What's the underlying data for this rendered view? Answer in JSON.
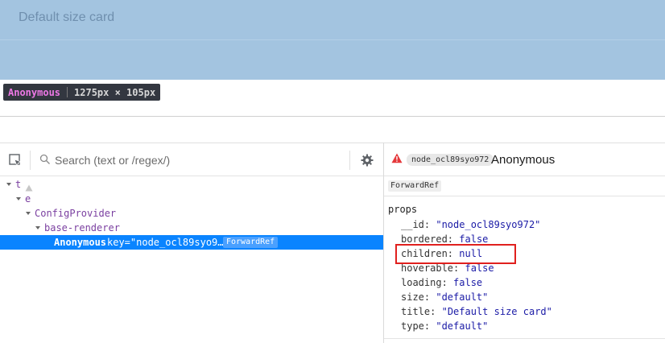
{
  "card": {
    "title": "Default size card"
  },
  "tooltip": {
    "name": "Anonymous",
    "size": "1275px × 105px"
  },
  "toolbar": {
    "search_placeholder": "Search (text or /regex/)"
  },
  "tree": {
    "nodes": [
      {
        "label": "t"
      },
      {
        "label": "e"
      },
      {
        "label": "ConfigProvider"
      },
      {
        "label": "base-renderer"
      },
      {
        "label": "Anonymous",
        "key": "key=\"node_ocl89syo9…\"",
        "badge": "ForwardRef"
      }
    ]
  },
  "inspector": {
    "id_chip": "node_ocl89syo972",
    "component_name": "Anonymous",
    "type_badge": "ForwardRef",
    "props_title": "props",
    "props": [
      {
        "key": "__id:",
        "value": "\"node_ocl89syo972\""
      },
      {
        "key": "bordered:",
        "value": "false"
      },
      {
        "key": "children:",
        "value": "null"
      },
      {
        "key": "hoverable:",
        "value": "false"
      },
      {
        "key": "loading:",
        "value": "false"
      },
      {
        "key": "size:",
        "value": "\"default\""
      },
      {
        "key": "title:",
        "value": "\"Default size card\""
      },
      {
        "key": "type:",
        "value": "\"default\""
      }
    ]
  },
  "colors": {
    "accent": "#0a84ff",
    "highlight": "#e0201e",
    "component": "#7a3fa0"
  }
}
